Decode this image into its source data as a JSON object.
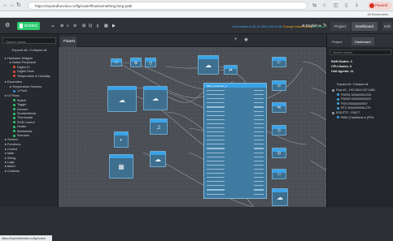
{
  "browser": {
    "url": "https://expiredfunction.ru/flg/node#flow/something-long-path",
    "profile_label": "Paused",
    "bookmark_label": "All Bookmarks"
  },
  "toolbar": {
    "nodes_button": "NODES",
    "status_connected": "Connected at 20.11.2024 09:24:38",
    "status_changes": "Change Made (web)",
    "status_online": "Online",
    "language": "English",
    "tab_project": "Project",
    "tab_dashboard": "Dashboard",
    "tab_extra": "Edit"
  },
  "left_panel": {
    "search_placeholder": "Search nodes",
    "expand_collapse": "Expand all / Collapse all",
    "items": [
      {
        "label": "Hardware Widgets",
        "level": 0
      },
      {
        "label": "Native Peripheral",
        "level": 1
      },
      {
        "label": "Digital IO",
        "level": 2,
        "color": "#e74c3c"
      },
      {
        "label": "Digital Timer",
        "level": 2,
        "color": "#e74c3c"
      },
      {
        "label": "Temperature & Humidity",
        "level": 2,
        "color": "#e74c3c"
      },
      {
        "label": "Expanders",
        "level": 0
      },
      {
        "label": "Temperature Sensors",
        "level": 1
      },
      {
        "label": "1-Point",
        "level": 2,
        "color": "#3498db"
      },
      {
        "label": "UI Flows",
        "level": 0
      },
      {
        "label": "Switch",
        "level": 2,
        "color": "#2ecc71"
      },
      {
        "label": "Toggle",
        "level": 2,
        "color": "#2ecc71"
      },
      {
        "label": "Dimmer",
        "level": 2,
        "color": "#2ecc71"
      },
      {
        "label": "Shutter/blinds",
        "level": 2,
        "color": "#2ecc71"
      },
      {
        "label": "Thermostat",
        "level": 2,
        "color": "#2ecc71"
      },
      {
        "label": "RGB Control",
        "level": 2,
        "color": "#2ecc71"
      },
      {
        "label": "Heater",
        "level": 2,
        "color": "#2ecc71"
      },
      {
        "label": "Multimedia",
        "level": 2,
        "color": "#2ecc71"
      },
      {
        "label": "Scenario",
        "level": 2,
        "color": "#2ecc71"
      },
      {
        "label": "Generic",
        "level": 0
      },
      {
        "label": "Functions",
        "level": 0
      },
      {
        "label": "Control",
        "level": 0
      },
      {
        "label": "Math",
        "level": 0
      },
      {
        "label": "String",
        "level": 0
      },
      {
        "label": "Logic",
        "level": 0
      },
      {
        "label": "Alarm",
        "level": 0
      },
      {
        "label": "Contexts",
        "level": 0
      }
    ],
    "status_url": "https://expiredfunction.ru/flg/node#"
  },
  "flow": {
    "tab_label": "Flow#1",
    "main_node_title": "Main_Controller_4"
  },
  "right_panel": {
    "search_placeholder": "Search events",
    "info_lines": [
      "RAM Nodes: 3",
      "CPU Nodes: 0",
      "Unit Agents: 11"
    ],
    "expand_collapse": "Expand all / Collapse all",
    "tree": [
      "Flow #1 - 192.168.0.187:1883",
      "FW001 000A00001234",
      "FW002 000A00000023",
      "FW3 0000A0000007",
      "RTC 000A00000A-279",
      "ESG/TTF - FD677",
      "RWD (Traditional & (PRA"
    ]
  }
}
